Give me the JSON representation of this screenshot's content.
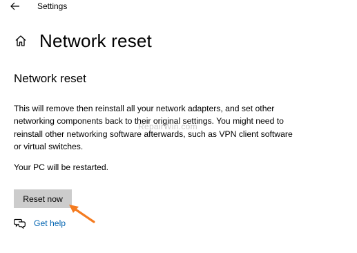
{
  "window": {
    "title": "Settings",
    "back_icon": "back-arrow-icon"
  },
  "header": {
    "home_icon": "home-icon",
    "title": "Network reset"
  },
  "main": {
    "section_heading": "Network reset",
    "description": "This will remove then reinstall all your network adapters, and set other networking components back to their original settings. You might need to reinstall other networking software afterwards, such as VPN client software or virtual switches.",
    "restart_note": "Your PC will be restarted.",
    "reset_button_label": "Reset now",
    "help_icon": "chat-help-icon",
    "help_link_label": "Get help"
  },
  "annotation": {
    "arrow_icon": "pointer-arrow-icon",
    "arrow_color": "#f47b20"
  },
  "watermark": {
    "text": "RepairWin.com"
  },
  "colors": {
    "background": "#ffffff",
    "button_bg": "#cccccc",
    "link": "#0063b1",
    "annotation_arrow": "#f47b20"
  }
}
